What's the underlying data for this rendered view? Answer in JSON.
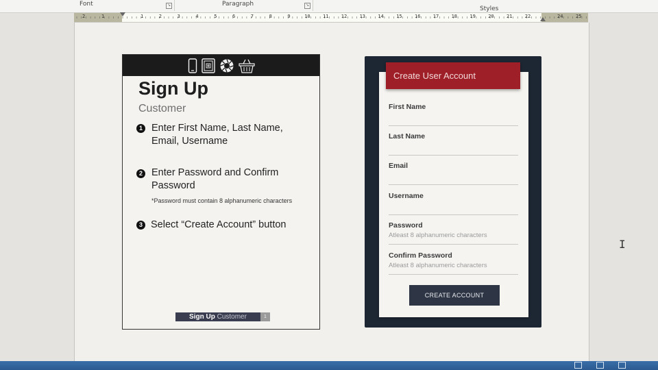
{
  "ribbon": {
    "groups": [
      "Font",
      "Paragraph",
      "Styles"
    ]
  },
  "ruler": {
    "left_numbers": [
      "2",
      "1"
    ],
    "numbers": [
      "1",
      "2",
      "3",
      "4",
      "5",
      "6",
      "7",
      "8",
      "9",
      "10",
      "11",
      "12",
      "13",
      "14",
      "15",
      "16",
      "17",
      "18",
      "19",
      "20",
      "21",
      "22"
    ],
    "right_numbers": [
      "24",
      "25"
    ]
  },
  "info_card": {
    "icons": [
      "smartphone-icon",
      "tablet-icon",
      "aperture-icon",
      "basket-icon"
    ],
    "title": "Sign Up",
    "subtitle": "Customer",
    "steps": [
      {
        "num": "1",
        "text": "Enter First Name, Last Name, Email, Username"
      },
      {
        "num": "2",
        "text": "Enter Password and Confirm Password",
        "note": "*Password must contain 8 alphanumeric characters"
      },
      {
        "num": "3",
        "text": "Select “Create Account” button"
      }
    ],
    "footer": {
      "bold": "Sign Up",
      "light": "Customer",
      "mini": "1"
    }
  },
  "form": {
    "header": "Create User Account",
    "fields": [
      {
        "label": "First Name",
        "hint": ""
      },
      {
        "label": "Last Name",
        "hint": ""
      },
      {
        "label": "Email",
        "hint": ""
      },
      {
        "label": "Username",
        "hint": ""
      },
      {
        "label": "Password",
        "hint": "Atleast 8 alphanumeric characters"
      },
      {
        "label": "Confirm Password",
        "hint": "Atleast 8 alphanumeric characters"
      }
    ],
    "button": "CREATE ACCOUNT"
  },
  "colors": {
    "form_header": "#9e1f27",
    "button": "#2e3646",
    "phone_frame": "#1d2633",
    "icon_bar": "#1b1b1b"
  }
}
